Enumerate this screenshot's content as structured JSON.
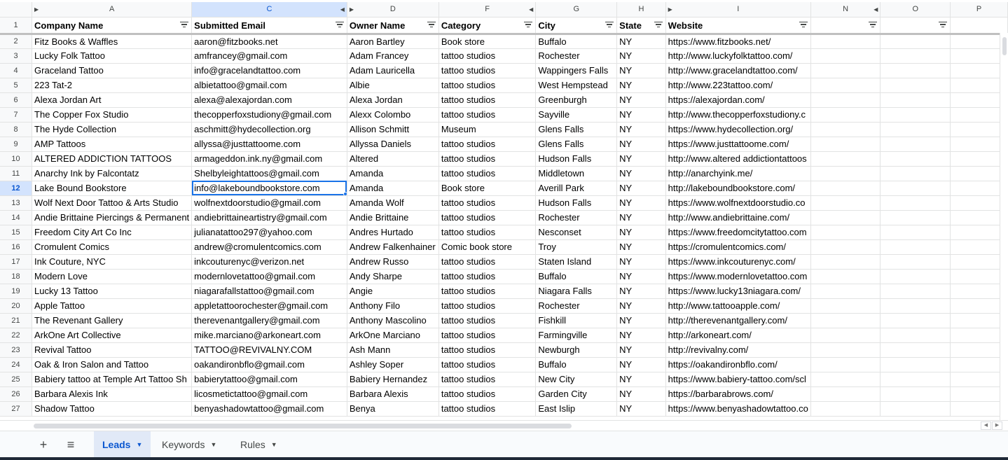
{
  "columns": [
    {
      "letter": "",
      "width": 46
    },
    {
      "letter": "A",
      "width": 225
    },
    {
      "letter": "C",
      "width": 222
    },
    {
      "letter": "D",
      "width": 131
    },
    {
      "letter": "F",
      "width": 139
    },
    {
      "letter": "G",
      "width": 116
    },
    {
      "letter": "H",
      "width": 70
    },
    {
      "letter": "I",
      "width": 205
    },
    {
      "letter": "N",
      "width": 101
    },
    {
      "letter": "O",
      "width": 101
    },
    {
      "letter": "P",
      "width": 83
    }
  ],
  "selected_column": "C",
  "selected_row": "12",
  "headers": [
    "Company Name",
    "Submitted Email",
    "Owner Name",
    "Category",
    "City",
    "State",
    "Website",
    "",
    ""
  ],
  "header_row_number": "1",
  "rows": [
    {
      "n": "2",
      "cells": [
        "Fitz Books & Waffles",
        "aaron@fitzbooks.net",
        "Aaron Bartley",
        "Book store",
        "Buffalo",
        "NY",
        "https://www.fitzbooks.net/"
      ]
    },
    {
      "n": "3",
      "cells": [
        "Lucky Folk Tattoo",
        "amfrancey@gmail.com",
        "Adam Francey",
        "tattoo studios",
        "Rochester",
        "NY",
        "http://www.luckyfolktattoo.com/"
      ]
    },
    {
      "n": "4",
      "cells": [
        "Graceland Tattoo",
        "info@gracelandtattoo.com",
        "Adam Lauricella",
        "tattoo studios",
        "Wappingers Falls",
        "NY",
        "http://www.gracelandtattoo.com/"
      ]
    },
    {
      "n": "5",
      "cells": [
        "223 Tat-2",
        "albietattoo@gmail.com",
        "Albie",
        "tattoo studios",
        "West Hempstead",
        "NY",
        "http://www.223tattoo.com/"
      ]
    },
    {
      "n": "6",
      "cells": [
        "Alexa Jordan Art",
        "alexa@alexajordan.com",
        "Alexa Jordan",
        "tattoo studios",
        "Greenburgh",
        "NY",
        "https://alexajordan.com/"
      ]
    },
    {
      "n": "7",
      "cells": [
        "The Copper Fox Studio",
        "thecopperfoxstudiony@gmail.com",
        "Alexx Colombo",
        "tattoo studios",
        "Sayville",
        "NY",
        "http://www.thecopperfoxstudiony.c"
      ]
    },
    {
      "n": "8",
      "cells": [
        "The Hyde Collection",
        "aschmitt@hydecollection.org",
        "Allison Schmitt",
        "Museum",
        "Glens Falls",
        "NY",
        "https://www.hydecollection.org/"
      ]
    },
    {
      "n": "9",
      "cells": [
        "AMP Tattoos",
        "allyssa@justtattoome.com",
        "Allyssa Daniels",
        "tattoo studios",
        "Glens Falls",
        "NY",
        "https://www.justtattoome.com/"
      ]
    },
    {
      "n": "10",
      "cells": [
        "ALTERED ADDICTION TATTOOS",
        "armageddon.ink.ny@gmail.com",
        "Altered",
        "tattoo studios",
        "Hudson Falls",
        "NY",
        "http://www.altered addictiontattoos"
      ]
    },
    {
      "n": "11",
      "cells": [
        "Anarchy Ink by Falcontatz",
        "Shelbyleightattoos@gmail.com",
        "Amanda",
        "tattoo studios",
        "Middletown",
        "NY",
        "http://anarchyink.me/"
      ]
    },
    {
      "n": "12",
      "cells": [
        "Lake Bound Bookstore",
        "info@lakeboundbookstore.com",
        "Amanda",
        "Book store",
        "Averill Park",
        "NY",
        "http://lakeboundbookstore.com/"
      ]
    },
    {
      "n": "13",
      "cells": [
        "Wolf Next Door Tattoo & Arts Studio",
        "wolfnextdoorstudio@gmail.com",
        "Amanda Wolf",
        "tattoo studios",
        "Hudson Falls",
        "NY",
        "https://www.wolfnextdoorstudio.co"
      ]
    },
    {
      "n": "14",
      "cells": [
        "Andie Brittaine Piercings & Permanent",
        "andiebrittaineartistry@gmail.com",
        "Andie Brittaine",
        "tattoo studios",
        "Rochester",
        "NY",
        "http://www.andiebrittaine.com/"
      ]
    },
    {
      "n": "15",
      "cells": [
        "Freedom City Art Co Inc",
        "julianatattoo297@yahoo.com",
        "Andres Hurtado",
        "tattoo studios",
        "Nesconset",
        "NY",
        "https://www.freedomcitytattoo.com"
      ]
    },
    {
      "n": "16",
      "cells": [
        "Cromulent Comics",
        "andrew@cromulentcomics.com",
        "Andrew Falkenhainer",
        "Comic book store",
        "Troy",
        "NY",
        "https://cromulentcomics.com/"
      ]
    },
    {
      "n": "17",
      "cells": [
        "Ink Couture, NYC",
        "inkcouturenyc@verizon.net",
        "Andrew Russo",
        "tattoo studios",
        "Staten Island",
        "NY",
        "https://www.inkcouturenyc.com/"
      ]
    },
    {
      "n": "18",
      "cells": [
        "Modern Love",
        "modernlovetattoo@gmail.com",
        "Andy Sharpe",
        "tattoo studios",
        "Buffalo",
        "NY",
        "https://www.modernlovetattoo.com"
      ]
    },
    {
      "n": "19",
      "cells": [
        "Lucky 13 Tattoo",
        "niagarafallstattoo@gmail.com",
        "Angie",
        "tattoo studios",
        "Niagara Falls",
        "NY",
        "https://www.lucky13niagara.com/"
      ]
    },
    {
      "n": "20",
      "cells": [
        "Apple Tattoo",
        "appletattoorochester@gmail.com",
        "Anthony Filo",
        "tattoo studios",
        "Rochester",
        "NY",
        "http://www.tattooapple.com/"
      ]
    },
    {
      "n": "21",
      "cells": [
        "The Revenant Gallery",
        "therevenantgallery@gmail.com",
        "Anthony Mascolino",
        "tattoo studios",
        "Fishkill",
        "NY",
        "http://therevenantgallery.com/"
      ]
    },
    {
      "n": "22",
      "cells": [
        "ArkOne Art Collective",
        "mike.marciano@arkoneart.com",
        "ArkOne Marciano",
        "tattoo studios",
        "Farmingville",
        "NY",
        "http://arkoneart.com/"
      ]
    },
    {
      "n": "23",
      "cells": [
        "Revival Tattoo",
        "TATTOO@REVIVALNY.COM",
        "Ash Mann",
        "tattoo studios",
        "Newburgh",
        "NY",
        "http://revivalny.com/"
      ]
    },
    {
      "n": "24",
      "cells": [
        "Oak & Iron Salon and Tattoo",
        "oakandironbflo@gmail.com",
        "Ashley Soper",
        "tattoo studios",
        "Buffalo",
        "NY",
        "https://oakandironbflo.com/"
      ]
    },
    {
      "n": "25",
      "cells": [
        "Babiery tattoo at Temple Art Tattoo Sh",
        "babierytattoo@gmail.com",
        "Babiery Hernandez",
        "tattoo studios",
        "New City",
        "NY",
        "https://www.babiery-tattoo.com/scl"
      ]
    },
    {
      "n": "26",
      "cells": [
        "Barbara Alexis Ink",
        "licosmetictattoo@gmail.com",
        "Barbara Alexis",
        "tattoo studios",
        "Garden City",
        "NY",
        "https://barbarabrows.com/"
      ]
    },
    {
      "n": "27",
      "cells": [
        "Shadow Tattoo",
        "benyashadowtattoo@gmail.com",
        "Benya",
        "tattoo studios",
        "East Islip",
        "NY",
        "https://www.benyashadowtattoo.co"
      ]
    }
  ],
  "tabs": {
    "add_icon": "+",
    "menu_icon": "≡",
    "sheets": [
      {
        "label": "Leads",
        "active": true
      },
      {
        "label": "Keywords",
        "active": false
      },
      {
        "label": "Rules",
        "active": false
      }
    ]
  },
  "colors": {
    "selection": "#d3e3fd",
    "accent": "#0b57d0",
    "active_border": "#1a73e8"
  }
}
